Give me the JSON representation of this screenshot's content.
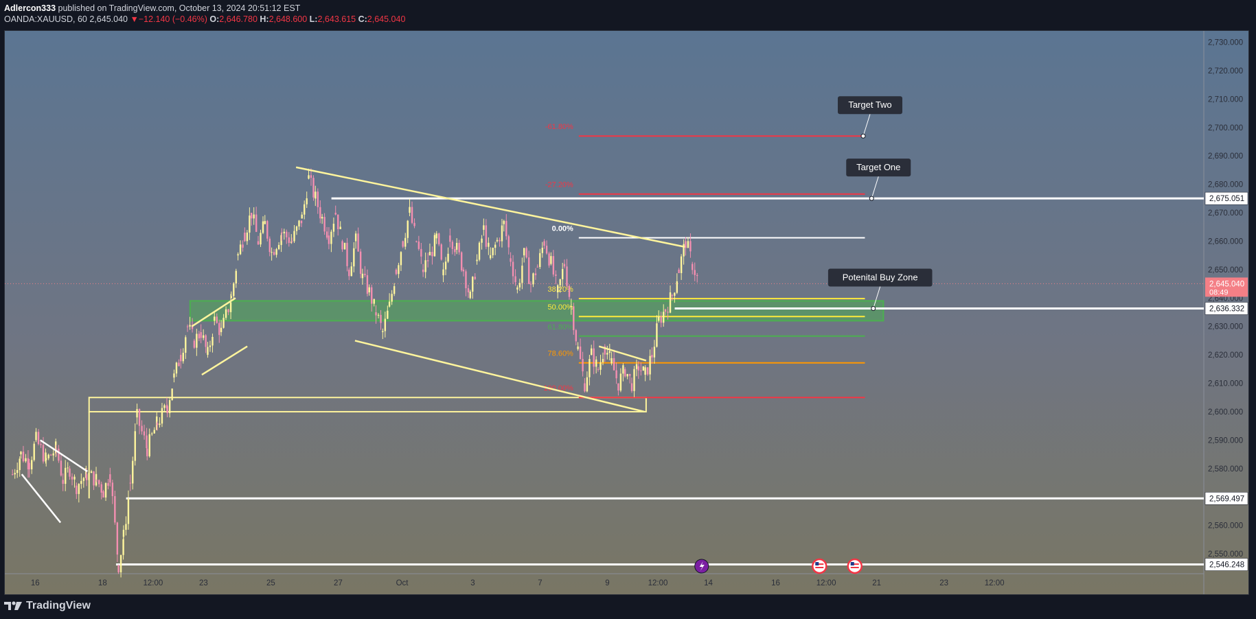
{
  "header": {
    "author": "Adlercon333",
    "published_text": "published on TradingView.com, October 13, 2024 20:51:12 EST",
    "symbol": "OANDA:XAUUSD, 60",
    "last_price": "2,645.040",
    "change_arrow": "▼",
    "change": "−12.140 (−0.46%)",
    "o_label": "O:",
    "o_value": "2,646.780",
    "h_label": "H:",
    "h_value": "2,648.600",
    "l_label": "L:",
    "l_value": "2,643.615",
    "c_label": "C:",
    "c_value": "2,645.040"
  },
  "footer": {
    "brand": "TradingView",
    "logo_icon": "tradingview-logo-icon"
  },
  "colors": {
    "bull": "#fff59d",
    "bear": "#f48fb1",
    "pattern": "#fff59d",
    "white_line": "#ffffff",
    "zone_fill": "#4caf50",
    "fib_red": "#f23645",
    "fib_orange": "#ff9800",
    "fib_green": "#4caf50",
    "fib_yellow": "#ffeb3b",
    "price_badge": "#f47f86"
  },
  "chart_data": {
    "type": "candlestick",
    "symbol": "OANDA:XAUUSD",
    "timeframe": "60",
    "ylim": [
      2543,
      2734
    ],
    "y_ticks": [
      2550,
      2560,
      2570,
      2580,
      2590,
      2600,
      2610,
      2620,
      2630,
      2640,
      2650,
      2660,
      2670,
      2680,
      2690,
      2700,
      2710,
      2720,
      2730
    ],
    "y_tick_labels": [
      "2,550.000",
      "2,560.000",
      "2,570.000",
      "2,580.000",
      "2,590.000",
      "2,600.000",
      "2,610.000",
      "2,620.000",
      "2,630.000",
      "2,640.000",
      "2,650.000",
      "2,660.000",
      "2,670.000",
      "2,680.000",
      "2,690.000",
      "2,700.000",
      "2,710.000",
      "2,720.000",
      "2,730.000"
    ],
    "x_ticks": [
      {
        "label": "16",
        "t": 2
      },
      {
        "label": "18",
        "t": 4
      },
      {
        "label": "12:00",
        "t": 5.5
      },
      {
        "label": "23",
        "t": 7
      },
      {
        "label": "25",
        "t": 9
      },
      {
        "label": "27",
        "t": 11
      },
      {
        "label": "Oct",
        "t": 12.9
      },
      {
        "label": "3",
        "t": 15
      },
      {
        "label": "7",
        "t": 17
      },
      {
        "label": "9",
        "t": 19
      },
      {
        "label": "12:00",
        "t": 20.5
      },
      {
        "label": "14",
        "t": 22
      },
      {
        "label": "16",
        "t": 24
      },
      {
        "label": "12:00",
        "t": 25.5
      },
      {
        "label": "21",
        "t": 27
      },
      {
        "label": "23",
        "t": 29
      },
      {
        "label": "12:00",
        "t": 30.5
      }
    ],
    "x_range": [
      1.3,
      31.15
    ],
    "price_series": [
      [
        1.3,
        2578
      ],
      [
        1.55,
        2585
      ],
      [
        1.8,
        2582
      ],
      [
        2.0,
        2590
      ],
      [
        2.3,
        2583
      ],
      [
        2.6,
        2587
      ],
      [
        2.8,
        2576
      ],
      [
        3.0,
        2580
      ],
      [
        3.2,
        2574
      ],
      [
        3.5,
        2578
      ],
      [
        3.8,
        2576
      ],
      [
        4.0,
        2572
      ],
      [
        4.2,
        2578
      ],
      [
        4.45,
        2546
      ],
      [
        4.6,
        2556
      ],
      [
        4.8,
        2575
      ],
      [
        5.0,
        2598
      ],
      [
        5.3,
        2587
      ],
      [
        5.6,
        2596
      ],
      [
        5.9,
        2602
      ],
      [
        6.1,
        2612
      ],
      [
        6.3,
        2620
      ],
      [
        6.5,
        2630
      ],
      [
        6.7,
        2625
      ],
      [
        6.9,
        2628
      ],
      [
        7.1,
        2620
      ],
      [
        7.3,
        2632
      ],
      [
        7.5,
        2628
      ],
      [
        7.8,
        2640
      ],
      [
        8.0,
        2655
      ],
      [
        8.2,
        2663
      ],
      [
        8.4,
        2670
      ],
      [
        8.6,
        2660
      ],
      [
        8.8,
        2666
      ],
      [
        9.0,
        2656
      ],
      [
        9.3,
        2663
      ],
      [
        9.6,
        2660
      ],
      [
        9.9,
        2668
      ],
      [
        10.1,
        2682
      ],
      [
        10.3,
        2675
      ],
      [
        10.5,
        2668
      ],
      [
        10.7,
        2662
      ],
      [
        10.9,
        2670
      ],
      [
        11.1,
        2660
      ],
      [
        11.3,
        2650
      ],
      [
        11.5,
        2660
      ],
      [
        11.7,
        2647
      ],
      [
        11.9,
        2642
      ],
      [
        12.1,
        2635
      ],
      [
        12.3,
        2628
      ],
      [
        12.5,
        2637
      ],
      [
        12.7,
        2650
      ],
      [
        12.9,
        2660
      ],
      [
        13.1,
        2670
      ],
      [
        13.3,
        2660
      ],
      [
        13.5,
        2650
      ],
      [
        13.7,
        2655
      ],
      [
        13.9,
        2661
      ],
      [
        14.1,
        2648
      ],
      [
        14.3,
        2662
      ],
      [
        14.5,
        2657
      ],
      [
        14.7,
        2650
      ],
      [
        14.9,
        2640
      ],
      [
        15.1,
        2653
      ],
      [
        15.3,
        2664
      ],
      [
        15.5,
        2654
      ],
      [
        15.7,
        2660
      ],
      [
        15.9,
        2666
      ],
      [
        16.1,
        2654
      ],
      [
        16.3,
        2643
      ],
      [
        16.5,
        2655
      ],
      [
        16.7,
        2645
      ],
      [
        16.9,
        2651
      ],
      [
        17.1,
        2660
      ],
      [
        17.3,
        2652
      ],
      [
        17.5,
        2642
      ],
      [
        17.7,
        2652
      ],
      [
        17.9,
        2637
      ],
      [
        18.1,
        2622
      ],
      [
        18.3,
        2610
      ],
      [
        18.5,
        2620
      ],
      [
        18.7,
        2615
      ],
      [
        18.9,
        2623
      ],
      [
        19.1,
        2617
      ],
      [
        19.3,
        2610
      ],
      [
        19.5,
        2615
      ],
      [
        19.7,
        2610
      ],
      [
        19.9,
        2616
      ],
      [
        20.1,
        2613
      ],
      [
        20.3,
        2620
      ],
      [
        20.5,
        2632
      ],
      [
        20.7,
        2636
      ],
      [
        20.9,
        2641
      ],
      [
        21.1,
        2650
      ],
      [
        21.3,
        2660
      ],
      [
        21.5,
        2652
      ],
      [
        21.7,
        2645
      ]
    ],
    "key_levels": [
      {
        "price": 2675.051,
        "label": "2,675.051",
        "t_start": 10.8
      },
      {
        "price": 2636.332,
        "label": "2,636.332",
        "t_start": 21.0
      },
      {
        "price": 2569.497,
        "label": "2,569.497",
        "t_start": 4.7
      },
      {
        "price": 2546.248,
        "label": "2,546.248",
        "t_start": 4.4
      }
    ],
    "current_price": {
      "price": 2645.04,
      "label": "2,645.040",
      "countdown": "08:49"
    },
    "fibonacci": {
      "t_start": 18.15,
      "t_end": 26.65,
      "levels": [
        {
          "ratio": "-61.80%",
          "price": 2697,
          "color": "#f23645"
        },
        {
          "ratio": "-27.20%",
          "price": 2676.6,
          "color": "#f23645"
        },
        {
          "ratio": "0.00%",
          "price": 2661.2,
          "color": "#ffffff"
        },
        {
          "ratio": "38.20%",
          "price": 2639.8,
          "color": "#ffeb3b"
        },
        {
          "ratio": "50.00%",
          "price": 2633.5,
          "color": "#ffeb3b"
        },
        {
          "ratio": "61.80%",
          "price": 2626.6,
          "color": "#4caf50"
        },
        {
          "ratio": "78.60%",
          "price": 2617.2,
          "color": "#ff9800"
        },
        {
          "ratio": "100.00%",
          "price": 2605,
          "color": "#f23645"
        }
      ]
    },
    "buy_zone": {
      "t_start": 6.6,
      "t_end": 27.2,
      "top": 2639,
      "bottom": 2632
    },
    "consolidation_box": {
      "t_start": 3.6,
      "t_end": 20.15,
      "top": 2605,
      "bottom": 2600
    },
    "trend_lines": [
      {
        "t1": 9.75,
        "p1": 2686,
        "t2": 21.3,
        "p2": 2658,
        "color": "pattern"
      },
      {
        "t1": 11.5,
        "p1": 2625,
        "t2": 20.1,
        "p2": 2600,
        "color": "pattern"
      },
      {
        "t1": 6.65,
        "p1": 2630,
        "t2": 7.95,
        "p2": 2640,
        "color": "pattern"
      },
      {
        "t1": 6.95,
        "p1": 2613,
        "t2": 8.3,
        "p2": 2623,
        "color": "pattern"
      },
      {
        "t1": 18.75,
        "p1": 2623,
        "t2": 20.15,
        "p2": 2618,
        "color": "pattern"
      },
      {
        "t1": 2.15,
        "p1": 2590,
        "t2": 3.55,
        "p2": 2579,
        "color": "white_line"
      },
      {
        "t1": 1.6,
        "p1": 2578,
        "t2": 2.75,
        "p2": 2561,
        "color": "white_line"
      }
    ],
    "annotations": [
      {
        "text": "Target Two",
        "price": 2697,
        "t": 26.6
      },
      {
        "text": "Target One",
        "price": 2675.051,
        "t": 26.85
      },
      {
        "text": "Potenital Buy Zone",
        "price": 2636.332,
        "t": 26.9
      }
    ]
  }
}
